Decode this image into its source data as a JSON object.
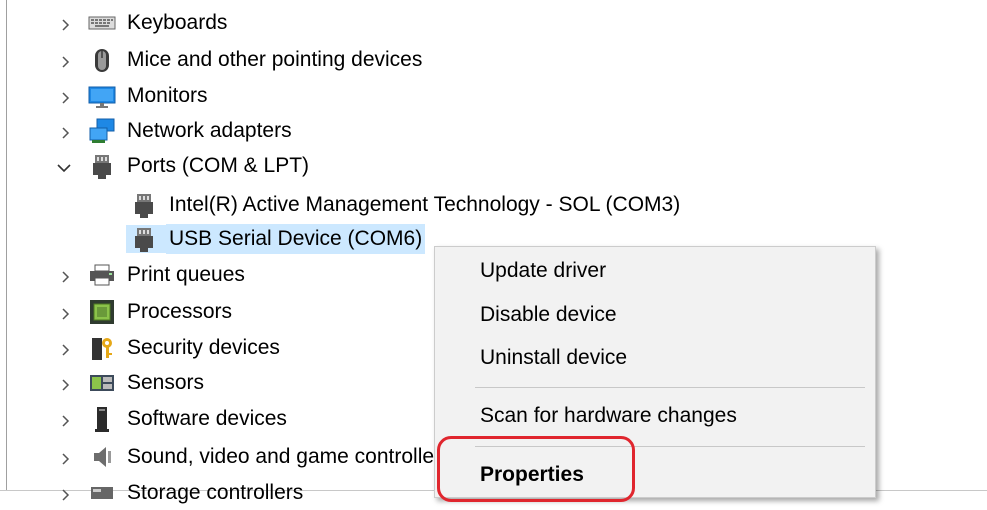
{
  "tree": {
    "items": [
      {
        "label": "Keyboards",
        "expanded": false,
        "icon": "keyboard-icon"
      },
      {
        "label": "Mice and other pointing devices",
        "expanded": false,
        "icon": "mouse-icon"
      },
      {
        "label": "Monitors",
        "expanded": false,
        "icon": "monitor-icon"
      },
      {
        "label": "Network adapters",
        "expanded": false,
        "icon": "network-icon"
      },
      {
        "label": "Ports (COM & LPT)",
        "expanded": true,
        "icon": "port-icon"
      },
      {
        "label": "Intel(R) Active Management Technology - SOL (COM3)",
        "icon": "port-icon"
      },
      {
        "label": "USB Serial Device (COM6)",
        "icon": "port-icon",
        "selected": true
      },
      {
        "label": "Print queues",
        "expanded": false,
        "icon": "printer-icon"
      },
      {
        "label": "Processors",
        "expanded": false,
        "icon": "processor-icon"
      },
      {
        "label": "Security devices",
        "expanded": false,
        "icon": "security-icon"
      },
      {
        "label": "Sensors",
        "expanded": false,
        "icon": "sensor-icon"
      },
      {
        "label": "Software devices",
        "expanded": false,
        "icon": "software-device-icon"
      },
      {
        "label": "Sound, video and game controllers",
        "expanded": false,
        "icon": "speaker-icon"
      },
      {
        "label": "Storage controllers",
        "expanded": false,
        "icon": "storage-icon"
      }
    ]
  },
  "context_menu": {
    "update_driver": "Update driver",
    "disable_device": "Disable device",
    "uninstall_device": "Uninstall device",
    "scan_hardware": "Scan for hardware changes",
    "properties": "Properties"
  },
  "colors": {
    "selection": "#cce8ff",
    "highlight_border": "#e0262e",
    "menu_background": "#f2f2f2"
  }
}
